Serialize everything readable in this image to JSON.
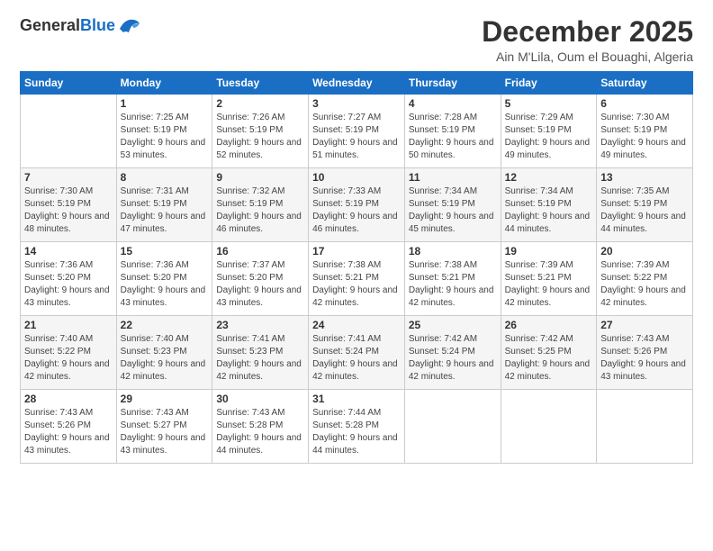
{
  "header": {
    "logo_general": "General",
    "logo_blue": "Blue",
    "month": "December 2025",
    "location": "Ain M'Lila, Oum el Bouaghi, Algeria"
  },
  "weekdays": [
    "Sunday",
    "Monday",
    "Tuesday",
    "Wednesday",
    "Thursday",
    "Friday",
    "Saturday"
  ],
  "weeks": [
    [
      {
        "day": "",
        "sunrise": "",
        "sunset": "",
        "daylight": ""
      },
      {
        "day": "1",
        "sunrise": "Sunrise: 7:25 AM",
        "sunset": "Sunset: 5:19 PM",
        "daylight": "Daylight: 9 hours and 53 minutes."
      },
      {
        "day": "2",
        "sunrise": "Sunrise: 7:26 AM",
        "sunset": "Sunset: 5:19 PM",
        "daylight": "Daylight: 9 hours and 52 minutes."
      },
      {
        "day": "3",
        "sunrise": "Sunrise: 7:27 AM",
        "sunset": "Sunset: 5:19 PM",
        "daylight": "Daylight: 9 hours and 51 minutes."
      },
      {
        "day": "4",
        "sunrise": "Sunrise: 7:28 AM",
        "sunset": "Sunset: 5:19 PM",
        "daylight": "Daylight: 9 hours and 50 minutes."
      },
      {
        "day": "5",
        "sunrise": "Sunrise: 7:29 AM",
        "sunset": "Sunset: 5:19 PM",
        "daylight": "Daylight: 9 hours and 49 minutes."
      },
      {
        "day": "6",
        "sunrise": "Sunrise: 7:30 AM",
        "sunset": "Sunset: 5:19 PM",
        "daylight": "Daylight: 9 hours and 49 minutes."
      }
    ],
    [
      {
        "day": "7",
        "sunrise": "Sunrise: 7:30 AM",
        "sunset": "Sunset: 5:19 PM",
        "daylight": "Daylight: 9 hours and 48 minutes."
      },
      {
        "day": "8",
        "sunrise": "Sunrise: 7:31 AM",
        "sunset": "Sunset: 5:19 PM",
        "daylight": "Daylight: 9 hours and 47 minutes."
      },
      {
        "day": "9",
        "sunrise": "Sunrise: 7:32 AM",
        "sunset": "Sunset: 5:19 PM",
        "daylight": "Daylight: 9 hours and 46 minutes."
      },
      {
        "day": "10",
        "sunrise": "Sunrise: 7:33 AM",
        "sunset": "Sunset: 5:19 PM",
        "daylight": "Daylight: 9 hours and 46 minutes."
      },
      {
        "day": "11",
        "sunrise": "Sunrise: 7:34 AM",
        "sunset": "Sunset: 5:19 PM",
        "daylight": "Daylight: 9 hours and 45 minutes."
      },
      {
        "day": "12",
        "sunrise": "Sunrise: 7:34 AM",
        "sunset": "Sunset: 5:19 PM",
        "daylight": "Daylight: 9 hours and 44 minutes."
      },
      {
        "day": "13",
        "sunrise": "Sunrise: 7:35 AM",
        "sunset": "Sunset: 5:19 PM",
        "daylight": "Daylight: 9 hours and 44 minutes."
      }
    ],
    [
      {
        "day": "14",
        "sunrise": "Sunrise: 7:36 AM",
        "sunset": "Sunset: 5:20 PM",
        "daylight": "Daylight: 9 hours and 43 minutes."
      },
      {
        "day": "15",
        "sunrise": "Sunrise: 7:36 AM",
        "sunset": "Sunset: 5:20 PM",
        "daylight": "Daylight: 9 hours and 43 minutes."
      },
      {
        "day": "16",
        "sunrise": "Sunrise: 7:37 AM",
        "sunset": "Sunset: 5:20 PM",
        "daylight": "Daylight: 9 hours and 43 minutes."
      },
      {
        "day": "17",
        "sunrise": "Sunrise: 7:38 AM",
        "sunset": "Sunset: 5:21 PM",
        "daylight": "Daylight: 9 hours and 42 minutes."
      },
      {
        "day": "18",
        "sunrise": "Sunrise: 7:38 AM",
        "sunset": "Sunset: 5:21 PM",
        "daylight": "Daylight: 9 hours and 42 minutes."
      },
      {
        "day": "19",
        "sunrise": "Sunrise: 7:39 AM",
        "sunset": "Sunset: 5:21 PM",
        "daylight": "Daylight: 9 hours and 42 minutes."
      },
      {
        "day": "20",
        "sunrise": "Sunrise: 7:39 AM",
        "sunset": "Sunset: 5:22 PM",
        "daylight": "Daylight: 9 hours and 42 minutes."
      }
    ],
    [
      {
        "day": "21",
        "sunrise": "Sunrise: 7:40 AM",
        "sunset": "Sunset: 5:22 PM",
        "daylight": "Daylight: 9 hours and 42 minutes."
      },
      {
        "day": "22",
        "sunrise": "Sunrise: 7:40 AM",
        "sunset": "Sunset: 5:23 PM",
        "daylight": "Daylight: 9 hours and 42 minutes."
      },
      {
        "day": "23",
        "sunrise": "Sunrise: 7:41 AM",
        "sunset": "Sunset: 5:23 PM",
        "daylight": "Daylight: 9 hours and 42 minutes."
      },
      {
        "day": "24",
        "sunrise": "Sunrise: 7:41 AM",
        "sunset": "Sunset: 5:24 PM",
        "daylight": "Daylight: 9 hours and 42 minutes."
      },
      {
        "day": "25",
        "sunrise": "Sunrise: 7:42 AM",
        "sunset": "Sunset: 5:24 PM",
        "daylight": "Daylight: 9 hours and 42 minutes."
      },
      {
        "day": "26",
        "sunrise": "Sunrise: 7:42 AM",
        "sunset": "Sunset: 5:25 PM",
        "daylight": "Daylight: 9 hours and 42 minutes."
      },
      {
        "day": "27",
        "sunrise": "Sunrise: 7:43 AM",
        "sunset": "Sunset: 5:26 PM",
        "daylight": "Daylight: 9 hours and 43 minutes."
      }
    ],
    [
      {
        "day": "28",
        "sunrise": "Sunrise: 7:43 AM",
        "sunset": "Sunset: 5:26 PM",
        "daylight": "Daylight: 9 hours and 43 minutes."
      },
      {
        "day": "29",
        "sunrise": "Sunrise: 7:43 AM",
        "sunset": "Sunset: 5:27 PM",
        "daylight": "Daylight: 9 hours and 43 minutes."
      },
      {
        "day": "30",
        "sunrise": "Sunrise: 7:43 AM",
        "sunset": "Sunset: 5:28 PM",
        "daylight": "Daylight: 9 hours and 44 minutes."
      },
      {
        "day": "31",
        "sunrise": "Sunrise: 7:44 AM",
        "sunset": "Sunset: 5:28 PM",
        "daylight": "Daylight: 9 hours and 44 minutes."
      },
      {
        "day": "",
        "sunrise": "",
        "sunset": "",
        "daylight": ""
      },
      {
        "day": "",
        "sunrise": "",
        "sunset": "",
        "daylight": ""
      },
      {
        "day": "",
        "sunrise": "",
        "sunset": "",
        "daylight": ""
      }
    ]
  ]
}
